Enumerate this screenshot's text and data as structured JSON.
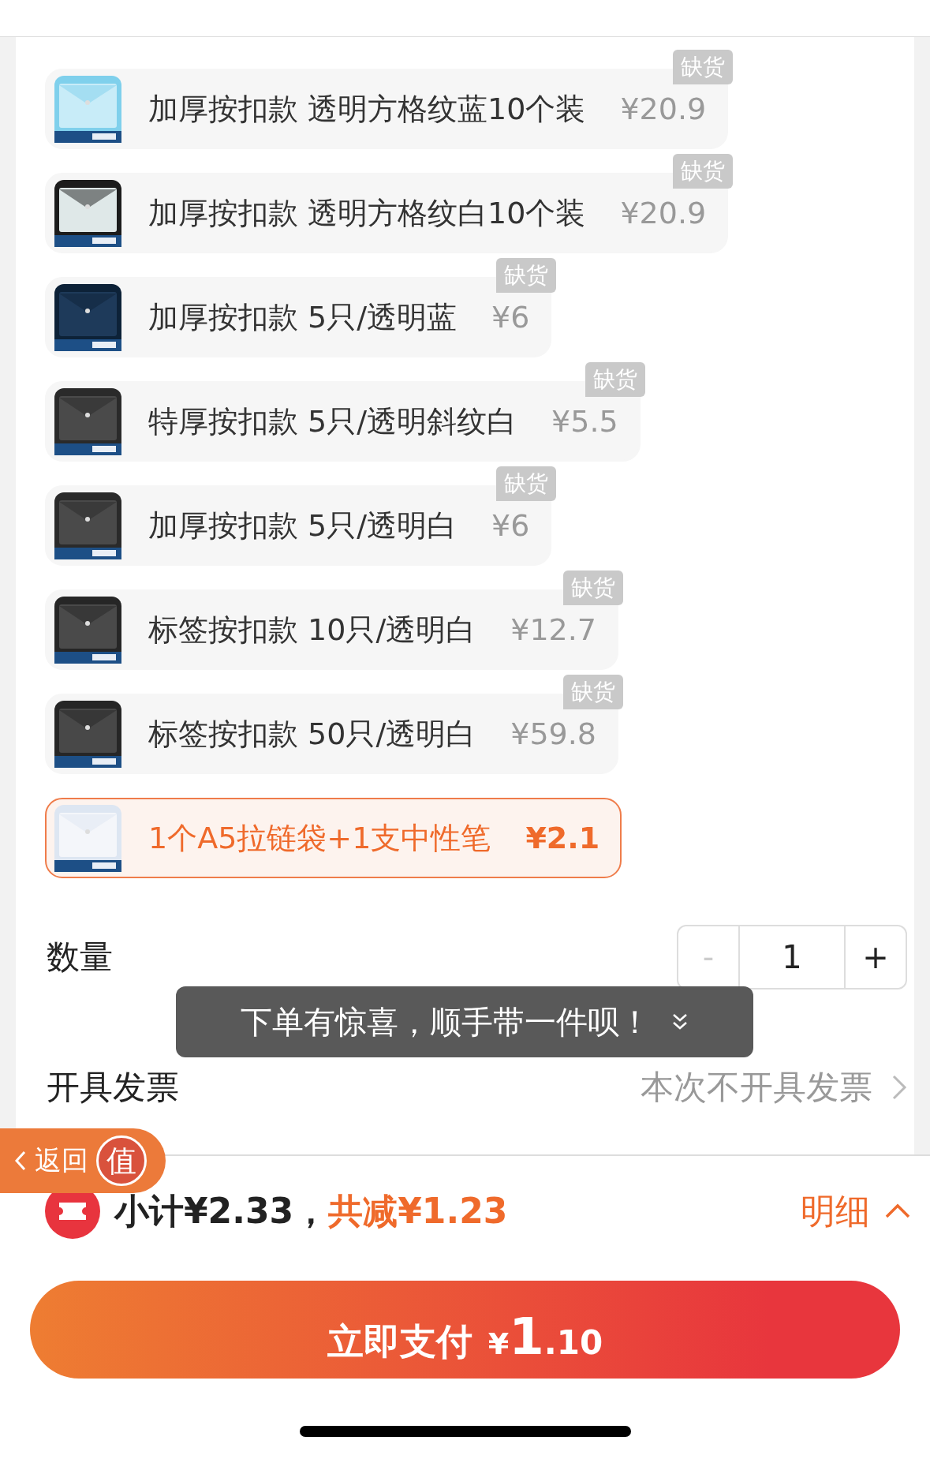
{
  "options": [
    {
      "name": "加厚按扣款 透明方格纹蓝10个装",
      "price": "¥20.9",
      "out_of_stock": true,
      "out_of_stock_label": "缺货",
      "selected": false
    },
    {
      "name": "加厚按扣款 透明方格纹白10个装",
      "price": "¥20.9",
      "out_of_stock": true,
      "out_of_stock_label": "缺货",
      "selected": false
    },
    {
      "name": "加厚按扣款 5只/透明蓝",
      "price": "¥6",
      "out_of_stock": true,
      "out_of_stock_label": "缺货",
      "selected": false
    },
    {
      "name": "特厚按扣款 5只/透明斜纹白",
      "price": "¥5.5",
      "out_of_stock": true,
      "out_of_stock_label": "缺货",
      "selected": false
    },
    {
      "name": "加厚按扣款 5只/透明白",
      "price": "¥6",
      "out_of_stock": true,
      "out_of_stock_label": "缺货",
      "selected": false
    },
    {
      "name": "标签按扣款 10只/透明白",
      "price": "¥12.7",
      "out_of_stock": true,
      "out_of_stock_label": "缺货",
      "selected": false
    },
    {
      "name": "标签按扣款 50只/透明白",
      "price": "¥59.8",
      "out_of_stock": true,
      "out_of_stock_label": "缺货",
      "selected": false
    },
    {
      "name": "1个A5拉链袋+1支中性笔",
      "price": "¥2.1",
      "out_of_stock": false,
      "selected": true
    }
  ],
  "quantity": {
    "label": "数量",
    "minus": "-",
    "value": "1",
    "plus": "+",
    "minus_disabled": true
  },
  "toast": {
    "text": "下单有惊喜，顺手带一件呗！"
  },
  "invoice": {
    "label": "开具发票",
    "value": "本次不开具发票"
  },
  "back_button": {
    "label": "返回",
    "badge": "值"
  },
  "summary": {
    "subtotal": "小计¥2.33，",
    "discount": "共减¥1.23",
    "details": "明细"
  },
  "pay_button": {
    "label": "立即支付",
    "currency": "¥",
    "amount_int": "1",
    "amount_dec": ".10"
  }
}
